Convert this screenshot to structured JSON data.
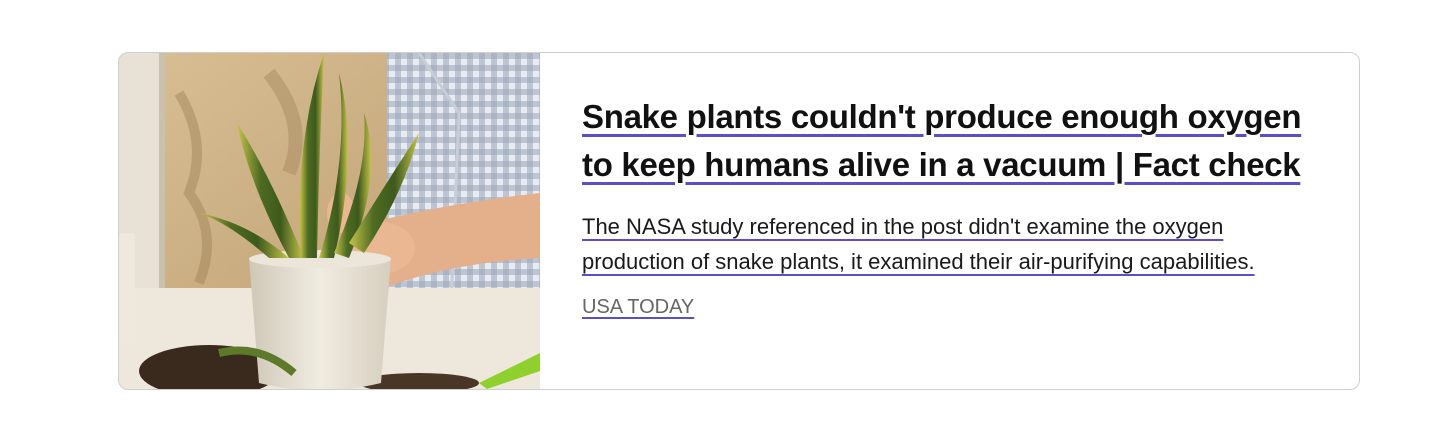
{
  "card": {
    "image_alt": "snake-plant-potting-photo",
    "headline": "Snake plants couldn't produce enough oxygen to keep humans alive in a vacuum | Fact check",
    "description": "The NASA study referenced in the post didn't examine the oxygen production of snake plants, it examined their air-purifying capabilities.",
    "source": "USA TODAY"
  },
  "colors": {
    "underline_accent": "#5a4fc8",
    "border": "#cfcfcf",
    "text": "#111111",
    "source_text": "#666666"
  }
}
